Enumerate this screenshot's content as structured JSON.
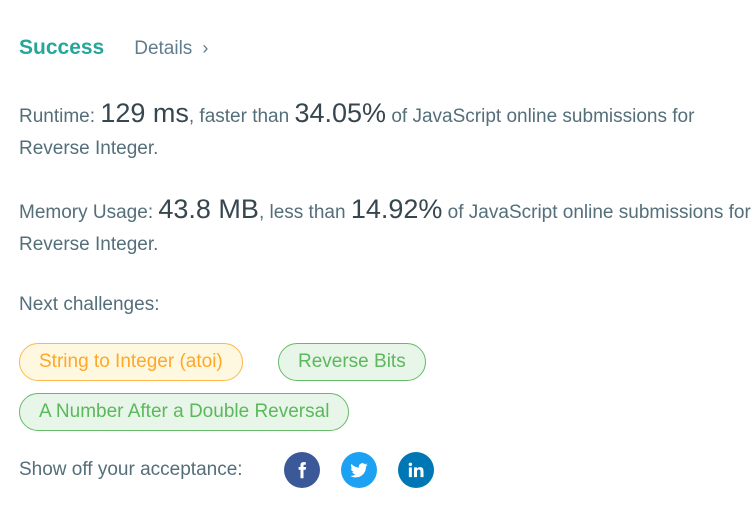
{
  "result": {
    "status": "Success",
    "details_label": "Details",
    "details_chevron": "›"
  },
  "runtime": {
    "label": "Runtime: ",
    "value": "129 ms",
    "compare_text": ", faster than ",
    "percent": "34.05%",
    "suffix": " of JavaScript online submissions for Reverse Integer."
  },
  "memory": {
    "label": "Memory Usage: ",
    "value": "43.8 MB",
    "compare_text": ", less than ",
    "percent": "14.92%",
    "suffix": " of JavaScript online submissions for Reverse Integer."
  },
  "next": {
    "label": "Next challenges:",
    "challenges": [
      {
        "title": "String to Integer (atoi)",
        "difficulty_color": "#ffa726"
      },
      {
        "title": "Reverse Bits",
        "difficulty_color": "#5cb85c"
      },
      {
        "title": "A Number After a Double Reversal",
        "difficulty_color": "#5cb85c"
      }
    ]
  },
  "share": {
    "label": "Show off your acceptance:",
    "networks": [
      {
        "icon": "facebook-icon",
        "color": "#3b5998"
      },
      {
        "icon": "twitter-icon",
        "color": "#1da1f2"
      },
      {
        "icon": "linkedin-icon",
        "color": "#0077b5"
      }
    ]
  }
}
